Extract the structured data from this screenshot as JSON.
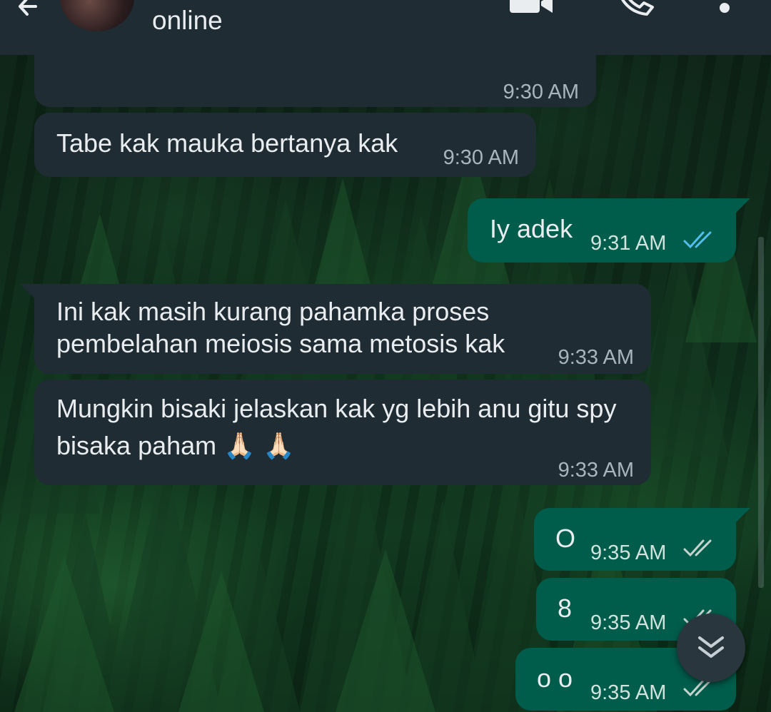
{
  "header": {
    "status": "online",
    "icons": [
      "back-arrow-icon",
      "avatar",
      "video-call-icon",
      "voice-call-icon",
      "more-options-icon"
    ]
  },
  "messages": [
    {
      "direction": "in",
      "text": "",
      "time": "9:30 AM"
    },
    {
      "direction": "in",
      "text": "Tabe kak mauka bertanya kak",
      "time": "9:30 AM"
    },
    {
      "direction": "out",
      "text": "Iy adek",
      "time": "9:31 AM",
      "status": "read"
    },
    {
      "direction": "in",
      "text_lines": [
        "Ini kak masih kurang pahamka proses",
        "pembelahan meiosis sama metosis kak"
      ],
      "time": "9:33 AM"
    },
    {
      "direction": "in",
      "text_lines": [
        "Mungkin bisaki jelaskan kak yg lebih anu gitu spy",
        "bisaka paham 🙏🏻 🙏🏻"
      ],
      "time": "9:33 AM"
    },
    {
      "direction": "out",
      "text": "O",
      "time": "9:35 AM",
      "status": "delivered"
    },
    {
      "direction": "out",
      "text": "8",
      "time": "9:35 AM",
      "status": "delivered"
    },
    {
      "direction": "out",
      "text": "o o",
      "time": "9:35 AM",
      "status": "delivered"
    }
  ],
  "colors": {
    "header_bg": "#1f2c33",
    "incoming_bubble": "#1f2c33",
    "outgoing_bubble": "#005c4b",
    "read_tick": "#53bdeb",
    "delivered_tick": "#c6d4d0"
  },
  "scroll_button": {
    "icon": "double-chevron-down-icon"
  }
}
